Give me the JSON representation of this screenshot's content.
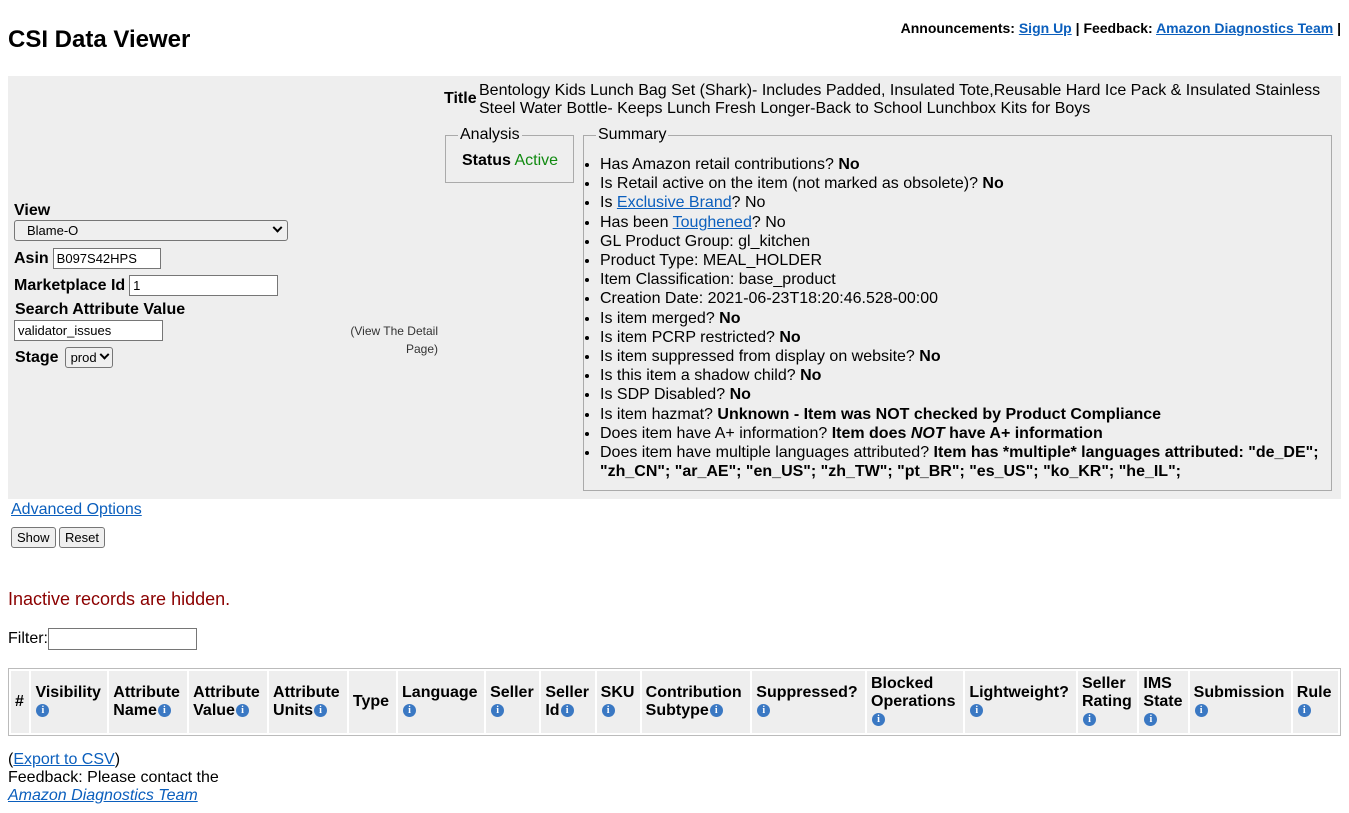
{
  "page": {
    "title": "CSI Data Viewer"
  },
  "topbar": {
    "announcements_label": "Announcements:",
    "signup_label": "Sign Up",
    "separator": "|",
    "feedback_label": "Feedback:",
    "feedback_link": "Amazon Diagnostics Team",
    "trailing": "|"
  },
  "form": {
    "view_label": "View",
    "view_value": "Blame-O",
    "asin_label": "Asin",
    "asin_value": "B097S42HPS",
    "marketplace_label": "Marketplace Id",
    "marketplace_value": "1",
    "search_label": "Search Attribute Value",
    "search_value": "validator_issues",
    "stage_label": "Stage",
    "stage_value": "prod",
    "detail_link": "(View The Detail Page)"
  },
  "item": {
    "title_label": "Title",
    "title_value": "Bentology Kids Lunch Bag Set (Shark)- Includes Padded, Insulated Tote,Reusable Hard Ice Pack & Insulated Stainless Steel Water Bottle- Keeps Lunch Fresh Longer-Back to School Lunchbox Kits for Boys"
  },
  "analysis": {
    "legend": "Analysis",
    "status_label": "Status",
    "status_value": "Active",
    "status_color": "#108a10"
  },
  "summary": {
    "legend": "Summary",
    "retail_contrib_q": "Has Amazon retail contributions?",
    "retail_contrib_a": "No",
    "retail_active_q": "Is Retail active on the item (not marked as obsolete)?",
    "retail_active_a": "No",
    "exclusive_pre": "Is",
    "exclusive_link": "Exclusive Brand",
    "exclusive_post": "? No",
    "toughened_pre": "Has been",
    "toughened_link": "Toughened",
    "toughened_post": "? No",
    "gl_group": "GL Product Group: gl_kitchen",
    "product_type": "Product Type: MEAL_HOLDER",
    "classification": "Item Classification: base_product",
    "creation_date": "Creation Date: 2021-06-23T18:20:46.528-00:00",
    "merged_q": "Is item merged?",
    "merged_a": "No",
    "pcrp_q": "Is item PCRP restricted?",
    "pcrp_a": "No",
    "suppressed_q": "Is item suppressed from display on website?",
    "suppressed_a": "No",
    "shadow_q": "Is this item a shadow child?",
    "shadow_a": "No",
    "sdp_q": "Is SDP Disabled?",
    "sdp_a": "No",
    "hazmat_q": "Is item hazmat?",
    "hazmat_a": "Unknown - Item was NOT checked by Product Compliance",
    "aplus_q": "Does item have A+ information?",
    "aplus_a1": "Item does",
    "aplus_a2": "NOT",
    "aplus_a3": "have A+ information",
    "lang_q": "Does item have multiple languages attributed?",
    "lang_a": "Item has *multiple* languages attributed: \"de_DE\"; \"zh_CN\"; \"ar_AE\"; \"en_US\"; \"zh_TW\"; \"pt_BR\"; \"es_US\"; \"ko_KR\"; \"he_IL\";"
  },
  "controls": {
    "advanced_options": "Advanced Options",
    "show_button": "Show",
    "reset_button": "Reset",
    "inactive_notice": "Inactive records are hidden.",
    "filter_label": "Filter:",
    "filter_value": ""
  },
  "table": {
    "info_glyph": "i",
    "col_num": "#",
    "col_visibility": "Visibility",
    "col_attr_name_1": "Attribute",
    "col_attr_name_2": "Name",
    "col_attr_value_1": "Attribute",
    "col_attr_value_2": "Value",
    "col_attr_units_1": "Attribute",
    "col_attr_units_2": "Units",
    "col_type": "Type",
    "col_language": "Language",
    "col_seller": "Seller",
    "col_seller_id_1": "Seller",
    "col_seller_id_2": "Id",
    "col_sku": "SKU",
    "col_contrib_1": "Contribution",
    "col_contrib_2": "Subtype",
    "col_suppressed": "Suppressed?",
    "col_blocked_1": "Blocked",
    "col_blocked_2": "Operations",
    "col_lightweight": "Lightweight?",
    "col_seller_rating_1": "Seller",
    "col_seller_rating_2": "Rating",
    "col_ims_1": "IMS",
    "col_ims_2": "State",
    "col_submission": "Submission",
    "col_rule": "Rule"
  },
  "footer": {
    "open_paren": "(",
    "export_link": "Export to CSV",
    "close_paren": ")",
    "feedback_text": "Feedback: Please contact the",
    "team_link": "Amazon Diagnostics Team"
  }
}
